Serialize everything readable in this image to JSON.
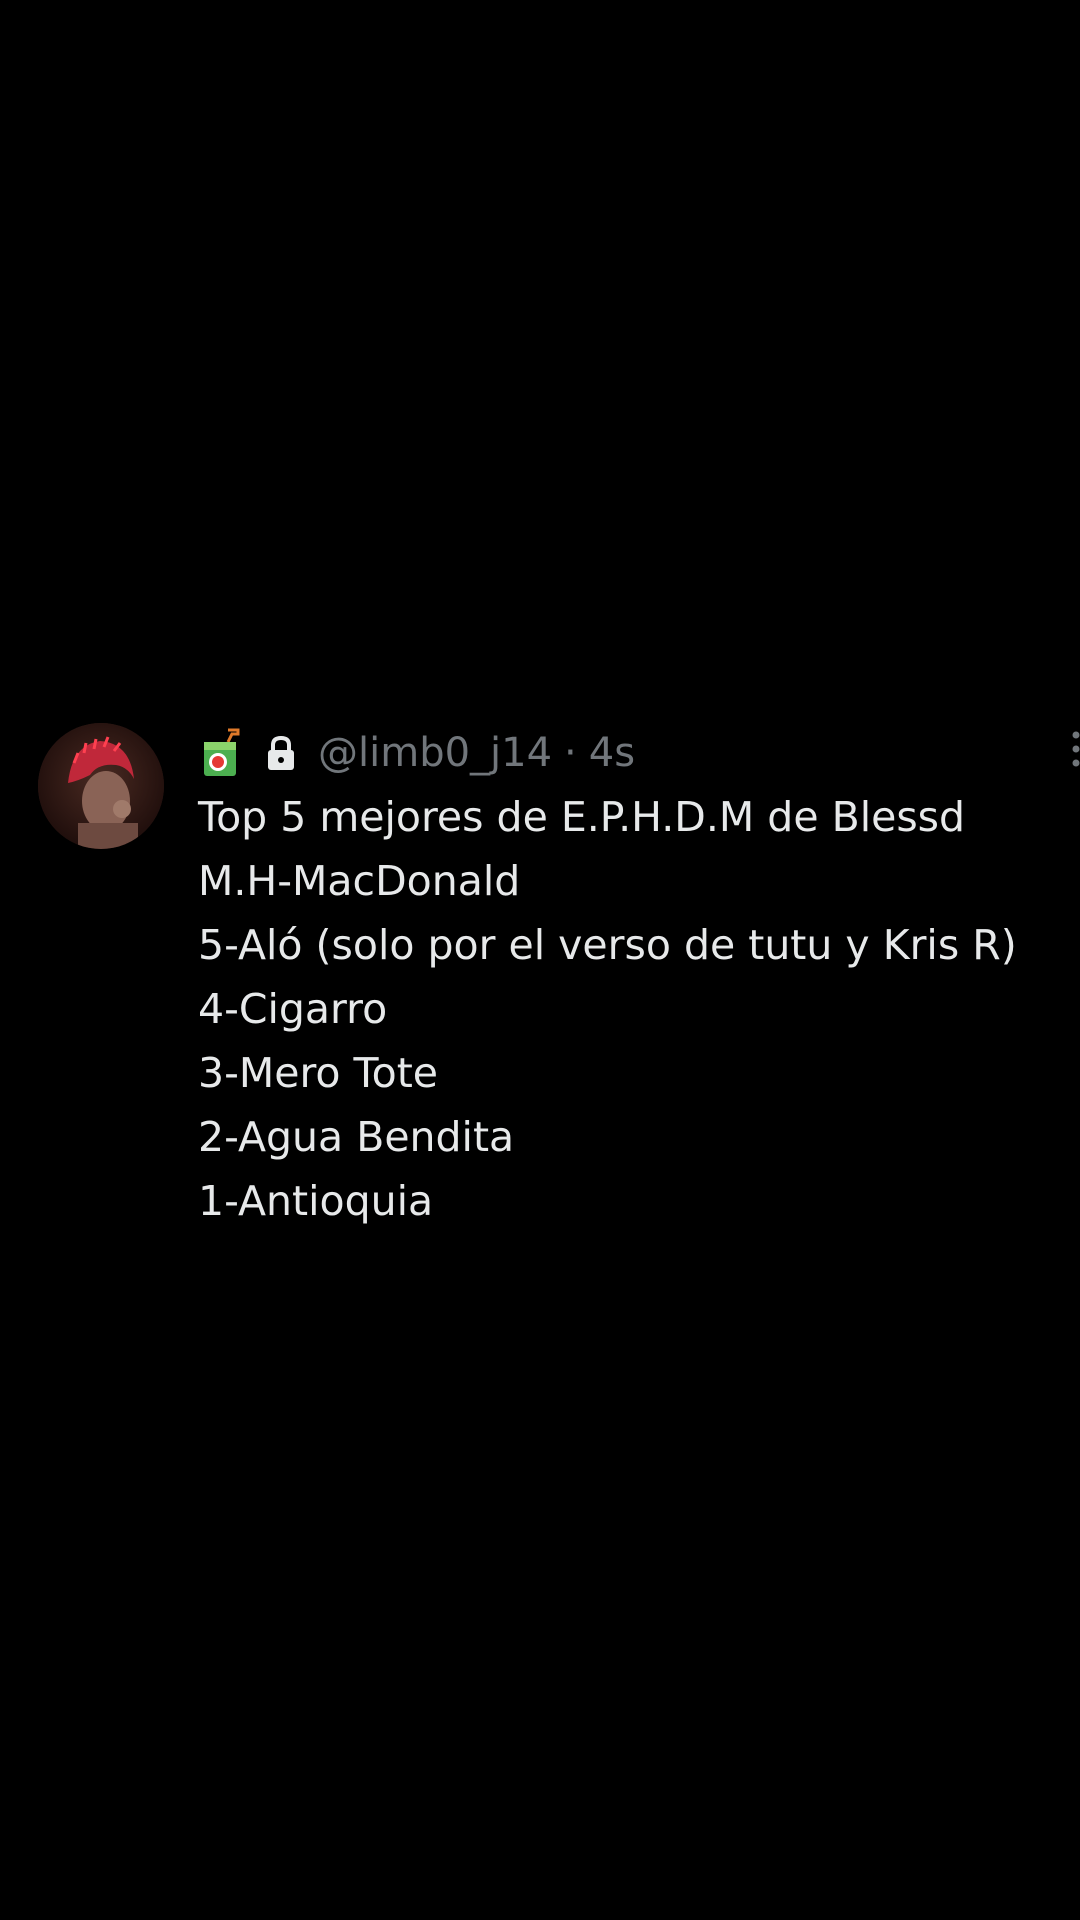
{
  "tweet": {
    "handle": "@limb0_j14",
    "separator": "·",
    "time": "4s",
    "emoji_icon": "juice-box-emoji-icon",
    "lock_icon": "lock-icon",
    "more_icon": "more-options-icon",
    "lines": [
      "Top 5 mejores de E.P.H.D.M de Blessd",
      "M.H-MacDonald",
      "5-Aló (solo por el verso de tutu y Kris R)",
      "4-Cigarro",
      "3-Mero Tote",
      "2-Agua Bendita",
      "1-Antioquia"
    ]
  },
  "colors": {
    "background": "#000000",
    "text_primary": "#e7e9ea",
    "text_secondary": "#71767b"
  }
}
